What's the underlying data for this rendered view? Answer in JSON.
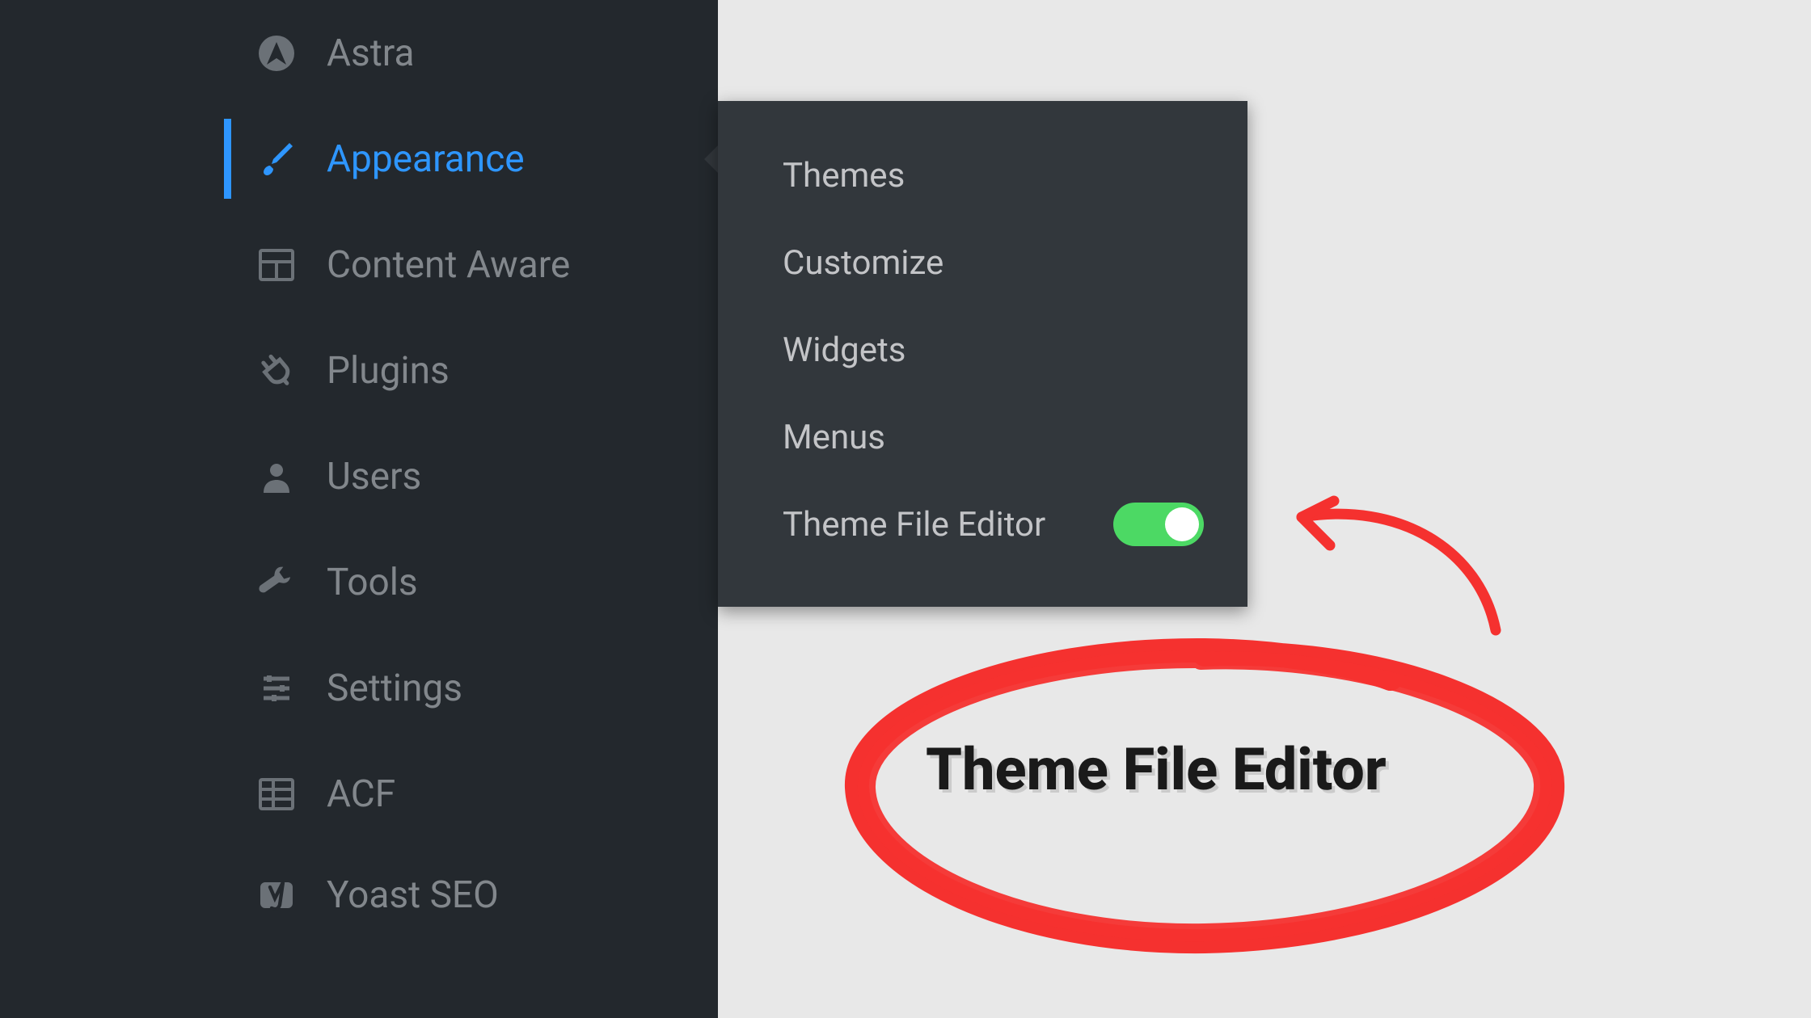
{
  "sidebar": {
    "items": [
      {
        "label": "Astra",
        "icon": "astra-icon",
        "active": false
      },
      {
        "label": "Appearance",
        "icon": "brush-icon",
        "active": true
      },
      {
        "label": "Content Aware",
        "icon": "layout-icon",
        "active": false
      },
      {
        "label": "Plugins",
        "icon": "plug-icon",
        "active": false
      },
      {
        "label": "Users",
        "icon": "user-icon",
        "active": false
      },
      {
        "label": "Tools",
        "icon": "wrench-icon",
        "active": false
      },
      {
        "label": "Settings",
        "icon": "sliders-icon",
        "active": false
      },
      {
        "label": "ACF",
        "icon": "acf-icon",
        "active": false
      },
      {
        "label": "Yoast SEO",
        "icon": "yoast-icon",
        "active": false
      }
    ]
  },
  "submenu": {
    "items": [
      {
        "label": "Themes"
      },
      {
        "label": "Customize"
      },
      {
        "label": "Widgets"
      },
      {
        "label": "Menus"
      },
      {
        "label": "Theme File Editor",
        "toggle": true
      }
    ]
  },
  "annotation": {
    "text": "Theme File Editor",
    "color": "#f5312f"
  }
}
